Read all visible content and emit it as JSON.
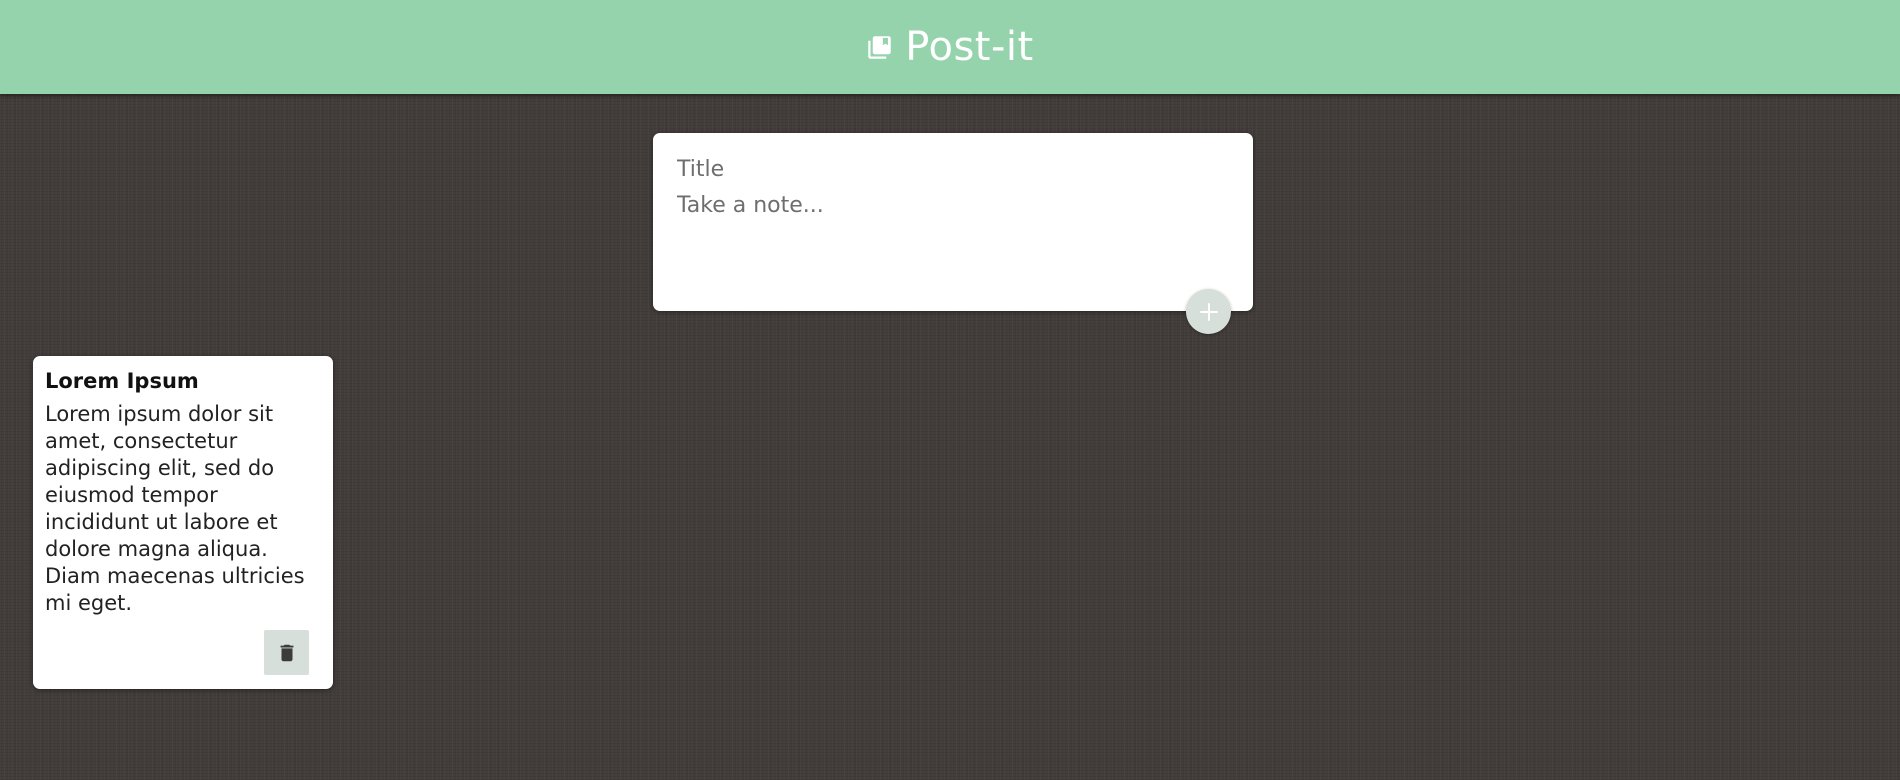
{
  "header": {
    "title": "Post-it",
    "icon": "notes-stack-icon",
    "background_color": "#95d3ad"
  },
  "create_note": {
    "title_placeholder": "Title",
    "content_placeholder": "Take a note...",
    "title_value": "",
    "content_value": "",
    "add_icon": "plus-icon"
  },
  "notes": [
    {
      "title": "Lorem Ipsum",
      "content": "Lorem ipsum dolor sit amet, consectetur adipiscing elit, sed do eiusmod tempor incididunt ut labore et dolore magna aliqua. Diam maecenas ultricies mi eget.",
      "delete_icon": "trash-icon"
    }
  ],
  "colors": {
    "background": "#433e3b",
    "accent": "#95d3ad",
    "button_bg": "#d6dfda"
  }
}
